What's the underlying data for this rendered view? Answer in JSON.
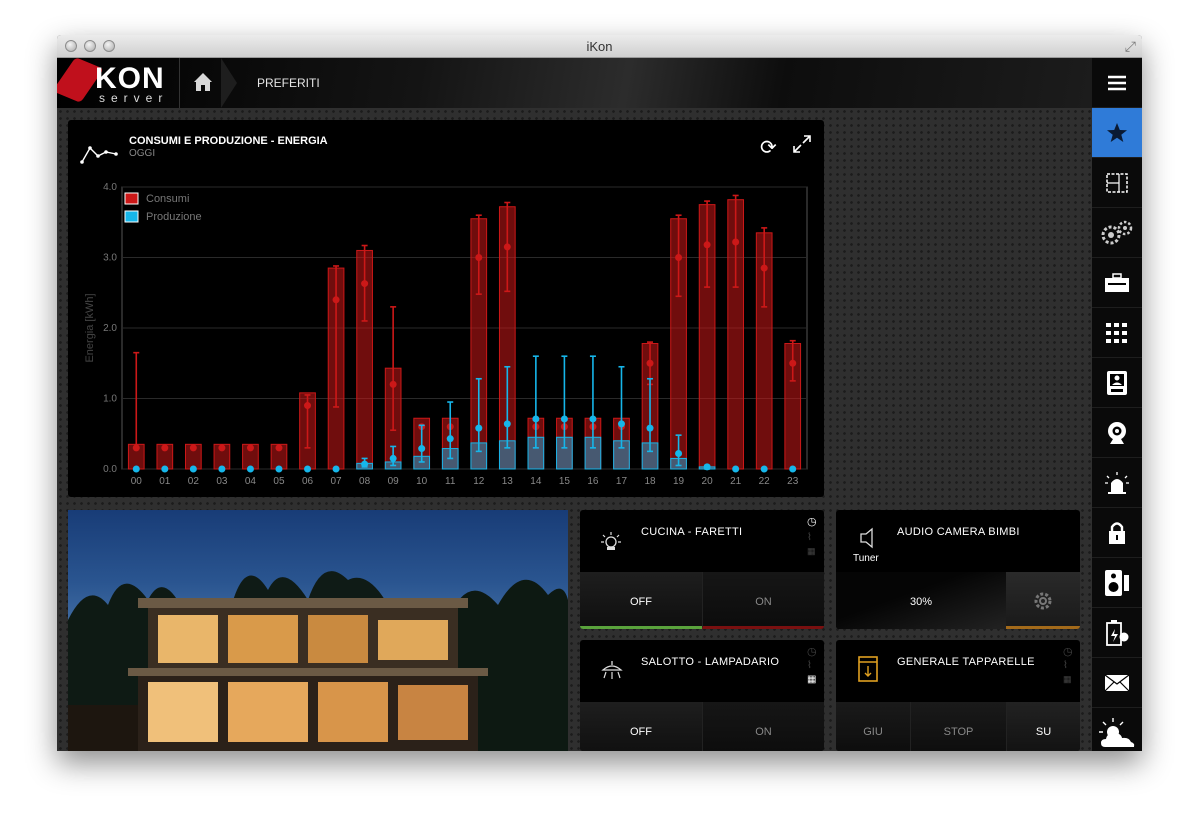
{
  "window": {
    "title": "iKon"
  },
  "header": {
    "logo_text": "KON",
    "logo_sub": "server",
    "breadcrumb": "PREFERITI"
  },
  "chart_panel": {
    "title": "CONSUMI E PRODUZIONE - ENERGIA",
    "subtitle": "OGGI"
  },
  "chart_data": {
    "type": "bar",
    "categories": [
      "00",
      "01",
      "02",
      "03",
      "04",
      "05",
      "06",
      "07",
      "08",
      "09",
      "10",
      "11",
      "12",
      "13",
      "14",
      "15",
      "16",
      "17",
      "18",
      "19",
      "20",
      "21",
      "22",
      "23"
    ],
    "ylabel": "Energia [kWh]",
    "ylim": [
      0,
      4.0
    ],
    "yticks": [
      "0.0",
      "1.0",
      "2.0",
      "3.0",
      "4.0"
    ],
    "legend_position": "top-left",
    "series": [
      {
        "name": "Consumi",
        "color": "#cc1818",
        "values": [
          0.35,
          0.35,
          0.35,
          0.35,
          0.35,
          0.35,
          1.08,
          2.85,
          3.1,
          1.43,
          0.72,
          0.72,
          3.55,
          3.72,
          0.72,
          0.72,
          0.72,
          0.72,
          1.78,
          3.55,
          3.75,
          3.82,
          3.35,
          1.78
        ],
        "mean": [
          0.3,
          0.3,
          0.3,
          0.3,
          0.3,
          0.3,
          0.9,
          2.4,
          2.63,
          1.2,
          0.6,
          0.6,
          3.0,
          3.15,
          0.6,
          0.6,
          0.6,
          0.6,
          1.5,
          3.0,
          3.18,
          3.22,
          2.85,
          1.5
        ],
        "err_low": [
          0.3,
          0.3,
          0.3,
          0.3,
          0.3,
          0.3,
          0.3,
          0.88,
          2.1,
          0.55,
          0.6,
          0.6,
          2.48,
          2.52,
          0.6,
          0.6,
          0.6,
          0.6,
          1.2,
          2.45,
          2.58,
          2.58,
          2.3,
          1.25
        ],
        "err_high": [
          1.65,
          0.3,
          0.3,
          0.3,
          0.3,
          0.3,
          1.05,
          2.88,
          3.17,
          2.3,
          0.6,
          0.6,
          3.6,
          3.78,
          0.6,
          0.6,
          0.6,
          0.6,
          1.8,
          3.6,
          3.8,
          3.88,
          3.42,
          1.82
        ]
      },
      {
        "name": "Produzione",
        "color": "#16b6ea",
        "values": [
          0,
          0,
          0,
          0,
          0,
          0,
          0,
          0,
          0.08,
          0.1,
          0.18,
          0.29,
          0.37,
          0.4,
          0.45,
          0.45,
          0.45,
          0.4,
          0.37,
          0.15,
          0.03,
          0,
          0,
          0
        ],
        "mean": [
          0,
          0,
          0,
          0,
          0,
          0,
          0,
          0,
          0.07,
          0.15,
          0.29,
          0.43,
          0.58,
          0.64,
          0.71,
          0.71,
          0.71,
          0.64,
          0.58,
          0.22,
          0.03,
          0,
          0,
          0
        ],
        "err_low": [
          0,
          0,
          0,
          0,
          0,
          0,
          0,
          0,
          0.03,
          0.05,
          0.1,
          0.15,
          0.25,
          0.3,
          0.3,
          0.3,
          0.3,
          0.3,
          0.25,
          0.05,
          0.0,
          0,
          0,
          0
        ],
        "err_high": [
          0,
          0,
          0,
          0,
          0,
          0,
          0,
          0,
          0.15,
          0.32,
          0.62,
          0.95,
          1.28,
          1.45,
          1.6,
          1.6,
          1.6,
          1.45,
          1.28,
          0.48,
          0.05,
          0,
          0,
          0
        ]
      }
    ]
  },
  "tiles": {
    "cucina": {
      "label": "CUCINA - FARETTI",
      "off": "OFF",
      "on": "ON"
    },
    "audio": {
      "label": "AUDIO CAMERA BIMBI",
      "source": "Tuner",
      "volume": "30%"
    },
    "salotto": {
      "label": "SALOTTO - LAMPADARIO",
      "off": "OFF",
      "on": "ON"
    },
    "tapparelle": {
      "label": "GENERALE TAPPARELLE",
      "giu": "GIU",
      "stop": "STOP",
      "su": "SU"
    }
  },
  "sidebar": {
    "items": [
      "menu-icon",
      "star-icon",
      "floorplan-icon",
      "settings-icon",
      "toolbox-icon",
      "keypad-icon",
      "intercom-icon",
      "camera-icon",
      "alarm-icon",
      "lock-icon",
      "speaker-icon",
      "energy-icon",
      "mail-icon",
      "weather-icon"
    ],
    "active_index": 1,
    "active_color": "#2f7bd8"
  },
  "colors": {
    "accent_blue": "#2f7bd8",
    "brand_red": "#c0101c",
    "consumi": "#cc1818",
    "produzione": "#16b6ea"
  }
}
